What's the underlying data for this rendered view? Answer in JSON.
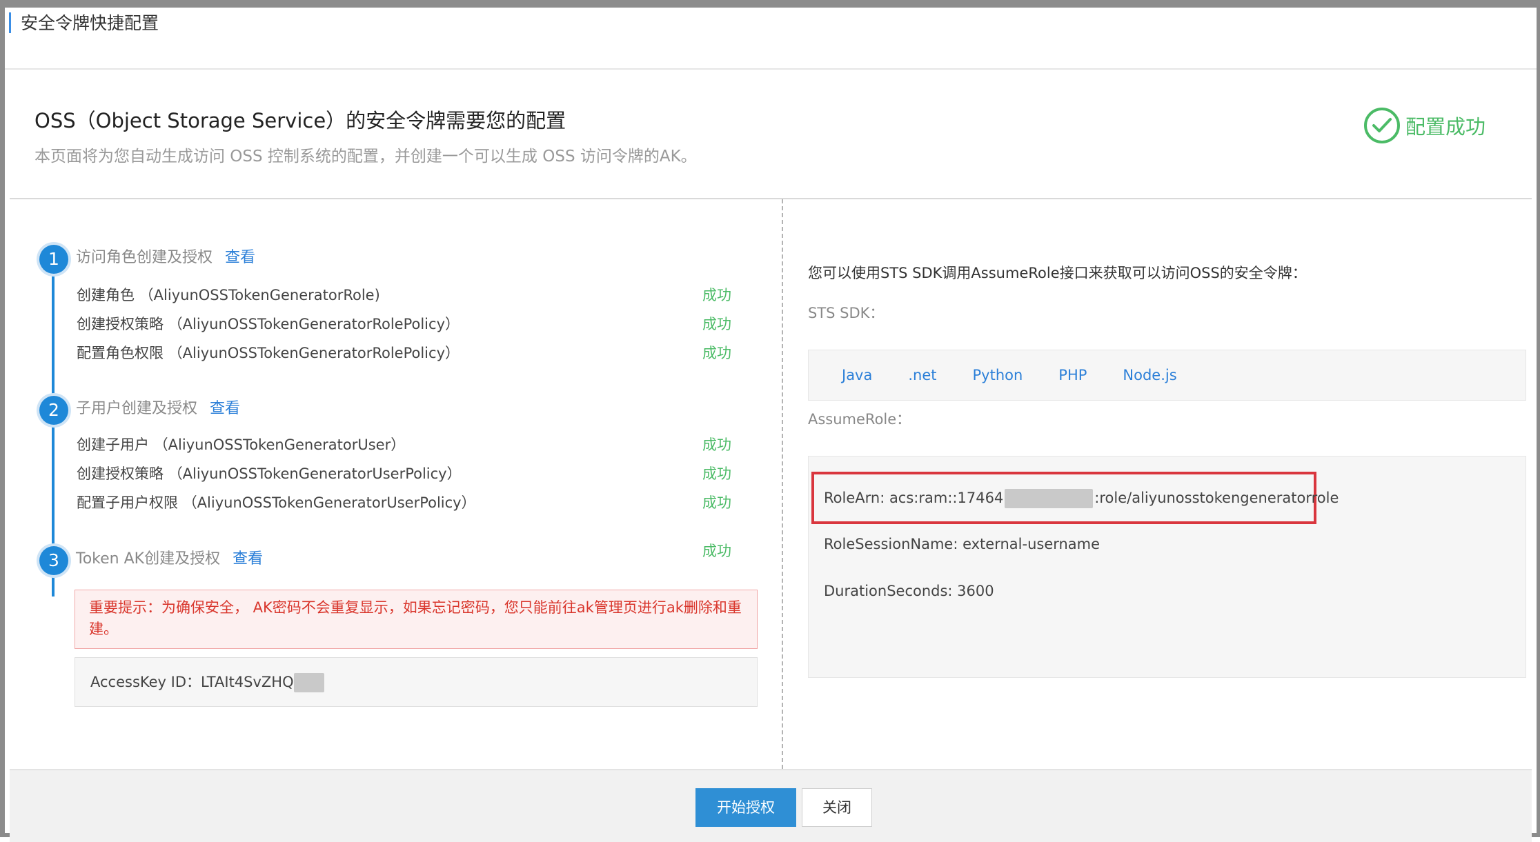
{
  "window": {
    "title": "安全令牌快捷配置"
  },
  "header": {
    "title": "OSS（Object Storage Service）的安全令牌需要您的配置",
    "subtitle": "本页面将为您自动生成访问 OSS 控制系统的配置，并创建一个可以生成 OSS 访问令牌的AK。",
    "status": "配置成功",
    "status_color": "#4bbb66"
  },
  "steps": [
    {
      "number": "1",
      "title": "访问角色创建及授权",
      "link": "查看",
      "items": [
        {
          "label": "创建角色 （AliyunOSSTokenGeneratorRole)",
          "status": "成功"
        },
        {
          "label": "创建授权策略 （AliyunOSSTokenGeneratorRolePolicy）",
          "status": "成功"
        },
        {
          "label": "配置角色权限 （AliyunOSSTokenGeneratorRolePolicy）",
          "status": "成功"
        }
      ]
    },
    {
      "number": "2",
      "title": "子用户创建及授权",
      "link": "查看",
      "items": [
        {
          "label": "创建子用户 （AliyunOSSTokenGeneratorUser）",
          "status": "成功"
        },
        {
          "label": "创建授权策略 （AliyunOSSTokenGeneratorUserPolicy）",
          "status": "成功"
        },
        {
          "label": "配置子用户权限 （AliyunOSSTokenGeneratorUserPolicy）",
          "status": "成功"
        }
      ]
    },
    {
      "number": "3",
      "title": "Token AK创建及授权",
      "link": "查看",
      "status": "成功"
    }
  ],
  "warning": "重要提示：为确保安全， AK密码不会重复显示，如果忘记密码，您只能前往ak管理页进行ak删除和重建。",
  "access_key": {
    "label": "AccessKey ID：LTAIt4SvZHQ"
  },
  "right": {
    "intro": "您可以使用STS SDK调用AssumeRole接口来获取可以访问OSS的安全令牌：",
    "sdk_label": "STS SDK：",
    "sdks": [
      "Java",
      ".net",
      "Python",
      "PHP",
      "Node.js"
    ],
    "assume_label": "AssumeRole：",
    "role_arn_prefix": "RoleArn: acs:ram::17464",
    "role_arn_suffix": ":role/aliyunosstokengeneratorrole",
    "role_session_name": "RoleSessionName: external-username",
    "duration": "DurationSeconds: 3600"
  },
  "footer": {
    "start_button": "开始授权",
    "close_button": "关闭"
  },
  "colors": {
    "accent": "#2f8fd5",
    "link": "#2b7fd8",
    "success": "#4bbb66",
    "warning": "#d9362c",
    "highlight_border": "#d9363e"
  }
}
